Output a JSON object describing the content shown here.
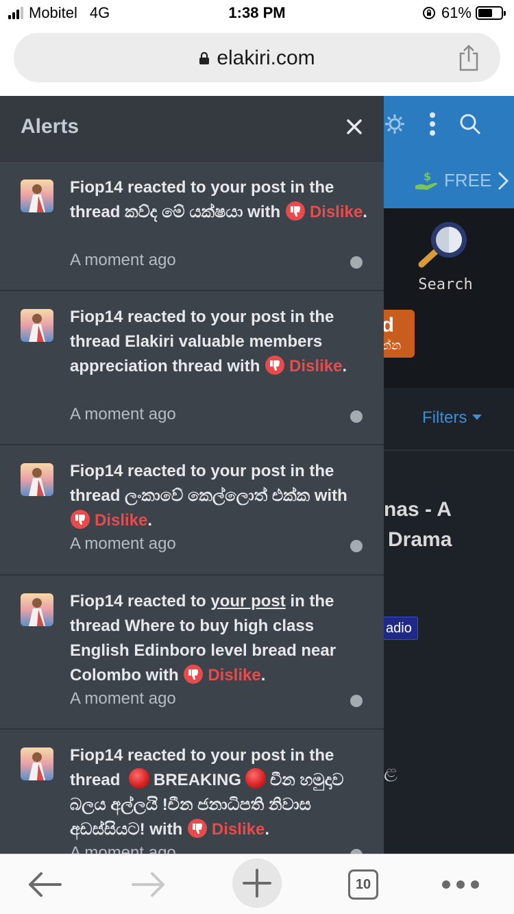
{
  "status_bar": {
    "carrier": "Mobitel",
    "network": "4G",
    "time": "1:38 PM",
    "battery": "61%",
    "battery_level": 0.61
  },
  "browser": {
    "url": "elakiri.com",
    "tab_count": "10"
  },
  "background": {
    "free_label": "FREE",
    "search_label": "Search",
    "thread_btn_line1": "ad",
    "thread_btn_line2": "න්න",
    "filters": "Filters",
    "title_line1": "nas - A",
    "title_line2": "Drama",
    "tag": "adio",
    "char": "ළ"
  },
  "alerts": {
    "title": "Alerts",
    "items": [
      {
        "user": "Fiop14",
        "pre": " reacted to your post in the thread කව්ද මේ යක්ෂයා with ",
        "reaction": "Dislike",
        "time": "A moment ago"
      },
      {
        "user": "Fiop14",
        "pre": " reacted to your post in the thread Elakiri valuable members appreciation thread with ",
        "reaction": "Dislike",
        "time": "A moment ago"
      },
      {
        "user": "Fiop14",
        "pre": " reacted to your post in the thread ලංකාවේ කෙල්ලොත් එක්ක with ",
        "reaction": "Dislike",
        "time": "A moment ago"
      },
      {
        "user": "Fiop14",
        "mid": " reacted to ",
        "link": "your post",
        "post": " in the thread Where to buy high class English Edinboro level bread near Colombo with ",
        "reaction": "Dislike",
        "time": "A moment ago"
      },
      {
        "user": "Fiop14",
        "pre": " reacted to your post in the thread ",
        "breaking": "BREAKING",
        "post": "චීන හමුදාව බලය අල්ලයි !චීන ජනාධිපති නිවාස අඩස්සියට! with ",
        "reaction": "Dislike",
        "time": "A moment ago"
      }
    ]
  },
  "colors": {
    "panel": "#3d434b",
    "header_blue": "#2a7bbf",
    "dislike": "#e84b4b",
    "filters": "#3c8fd6"
  }
}
